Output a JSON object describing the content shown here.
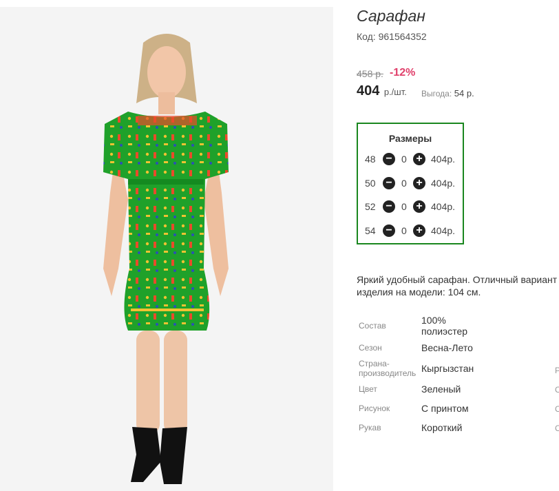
{
  "product": {
    "title": "Сарафан",
    "code_label": "Код:",
    "code_value": "961564352",
    "old_price": "458 р.",
    "discount": "-12%",
    "price": "404",
    "price_unit": "р./шт.",
    "savings_label": "Выгода:",
    "savings_value": "54 р."
  },
  "sizes": {
    "title": "Размеры",
    "minus_symbol": "−",
    "plus_symbol": "+",
    "rows": [
      {
        "size": "48",
        "qty": "0",
        "price": "404р."
      },
      {
        "size": "50",
        "qty": "0",
        "price": "404р."
      },
      {
        "size": "52",
        "qty": "0",
        "price": "404р."
      },
      {
        "size": "54",
        "qty": "0",
        "price": "404р."
      }
    ]
  },
  "description": {
    "line1": "Яркий удобный сарафан. Отличный вариант",
    "line2": "изделия на модели: 104 см."
  },
  "specs": [
    {
      "label": "Состав",
      "value_line1": "100%",
      "value_line2": "полиэстер"
    },
    {
      "label": "Сезон",
      "value": "Весна-Лето"
    },
    {
      "label_line1": "Страна-",
      "label_line2": "производитель",
      "value": "Кыргызстан"
    },
    {
      "label": "Цвет",
      "value": "Зеленый"
    },
    {
      "label": "Рисунок",
      "value": "С принтом"
    },
    {
      "label": "Рукав",
      "value": "Короткий"
    }
  ],
  "edge_chars": [
    "Р",
    "С",
    "С",
    "С"
  ],
  "colors": {
    "sizes_border": "#19861e",
    "discount": "#e0406b",
    "dress_green": "#1fa12a",
    "cart_button": "#c5ea3d"
  },
  "images": {
    "product_photo": "model-wearing-green-printed-dress"
  }
}
